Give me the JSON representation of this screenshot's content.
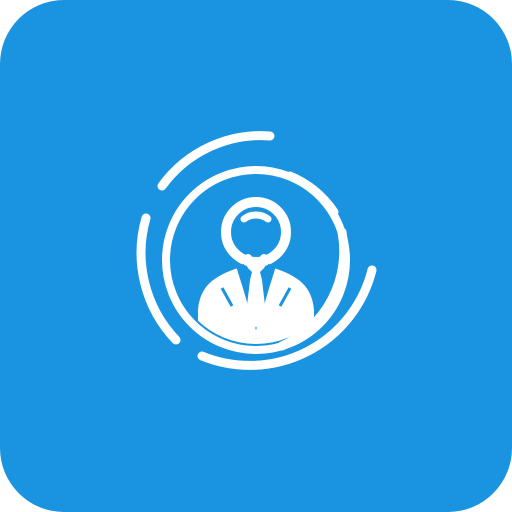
{
  "icon": {
    "name": "businessman-search-icon",
    "background_color": "#1a94e0",
    "foreground_color": "#ffffff"
  }
}
